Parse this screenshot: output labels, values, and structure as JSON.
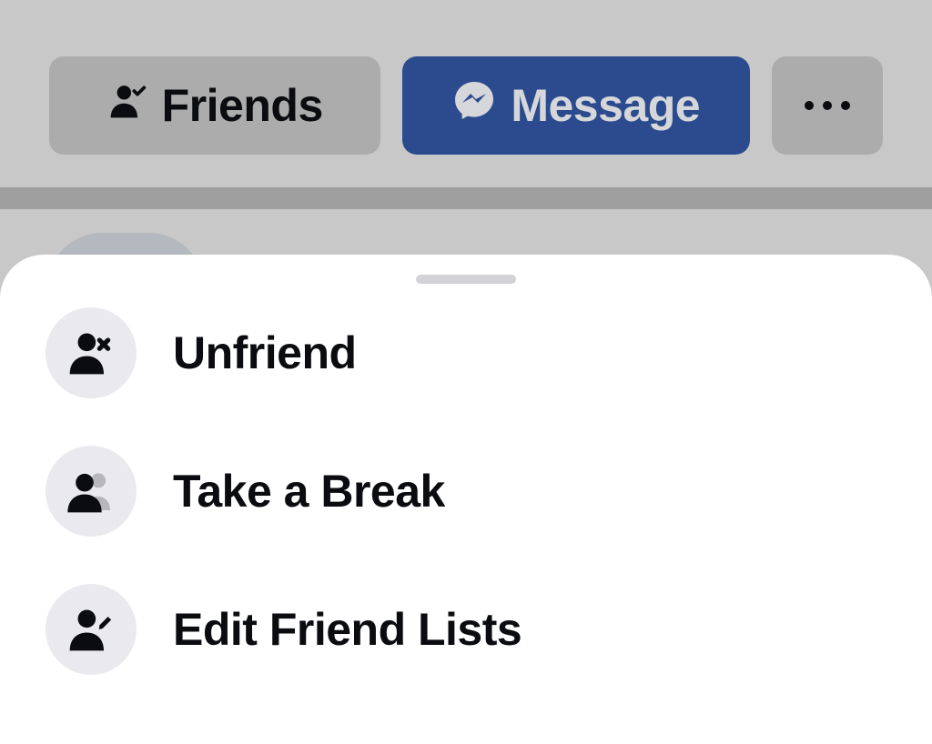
{
  "topbar": {
    "friends_label": "Friends",
    "message_label": "Message",
    "more_label": "•••"
  },
  "sheet": {
    "items": [
      {
        "label": "Unfriend",
        "icon": "person-x-icon"
      },
      {
        "label": "Take a Break",
        "icon": "people-icon"
      },
      {
        "label": "Edit Friend Lists",
        "icon": "person-edit-icon"
      }
    ]
  }
}
